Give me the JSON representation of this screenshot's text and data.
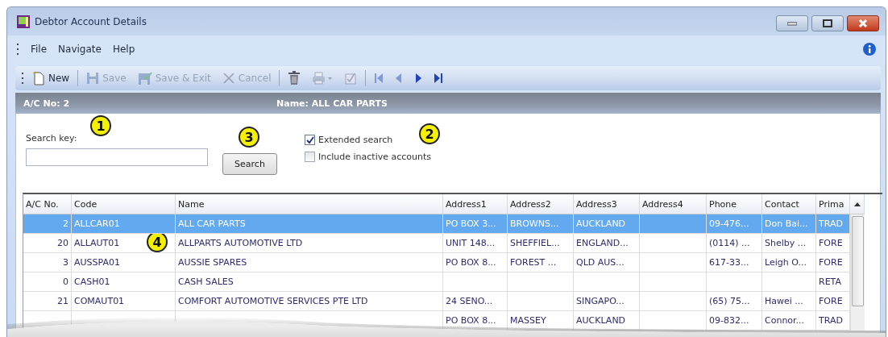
{
  "window": {
    "title": "Debtor Account Details"
  },
  "menu": [
    "File",
    "Navigate",
    "Help"
  ],
  "toolbar": [
    {
      "kind": "new",
      "label": "New",
      "disabled": false
    },
    {
      "kind": "separator"
    },
    {
      "kind": "save",
      "label": "Save",
      "disabled": true
    },
    {
      "kind": "save_exit",
      "label": "Save & Exit",
      "disabled": true
    },
    {
      "kind": "cancel",
      "label": "Cancel",
      "disabled": true
    },
    {
      "kind": "separator"
    },
    {
      "kind": "delete",
      "disabled": false
    },
    {
      "kind": "print",
      "disabled": true
    },
    {
      "kind": "report",
      "disabled": true
    },
    {
      "kind": "separator"
    },
    {
      "kind": "first",
      "disabled": true
    },
    {
      "kind": "prev",
      "disabled": true
    },
    {
      "kind": "next",
      "disabled": false
    },
    {
      "kind": "last",
      "disabled": false
    }
  ],
  "header": {
    "account": "A/C No: 2",
    "name": "Name: ALL CAR PARTS"
  },
  "search": {
    "label": "Search key:",
    "button": "Search",
    "options": [
      {
        "label": "Extended search",
        "checked": true
      },
      {
        "label": "Include inactive accounts",
        "checked": false
      }
    ]
  },
  "callouts": [
    "1",
    "2",
    "3",
    "4"
  ],
  "table": {
    "columns": [
      "A/C No.",
      "Code",
      "Name",
      "Address1",
      "Address2",
      "Address3",
      "Address4",
      "Phone",
      "Contact",
      "Prima"
    ],
    "rows": [
      {
        "selected": true,
        "cells": [
          "2",
          "ALLCAR01",
          "ALL CAR PARTS",
          "PO BOX 3...",
          "BROWNS...",
          "AUCKLAND",
          "",
          "09-476...",
          "Don Bai...",
          "TRAD"
        ]
      },
      {
        "selected": false,
        "cells": [
          "20",
          "ALLAUT01",
          "ALLPARTS AUTOMOTIVE LTD",
          "UNIT 148...",
          "SHEFFIEL...",
          "ENGLAND...",
          "",
          "(0114) ...",
          "Shelby ...",
          "FORE"
        ]
      },
      {
        "selected": false,
        "cells": [
          "3",
          "AUSSPA01",
          "AUSSIE SPARES",
          "PO BOX 8...",
          "FOREST ...",
          "QLD AUS...",
          "",
          "617-33...",
          "Leigh O...",
          "FORE"
        ]
      },
      {
        "selected": false,
        "cells": [
          "0",
          "CASH01",
          "CASH SALES",
          "",
          "",
          "",
          "",
          "",
          "",
          "RETA"
        ]
      },
      {
        "selected": false,
        "cells": [
          "21",
          "COMAUT01",
          "COMFORT AUTOMOTIVE SERVICES PTE LTD",
          "24 SENO...",
          "",
          "SINGAPO...",
          "",
          "(65) 75...",
          "Hawei ...",
          "FORE"
        ]
      },
      {
        "selected": false,
        "cells": [
          "",
          "",
          "",
          "PO BOX 8...",
          "MASSEY",
          "AUCKLAND",
          "",
          "09-832...",
          "Connor...",
          "TRAD"
        ]
      }
    ]
  }
}
